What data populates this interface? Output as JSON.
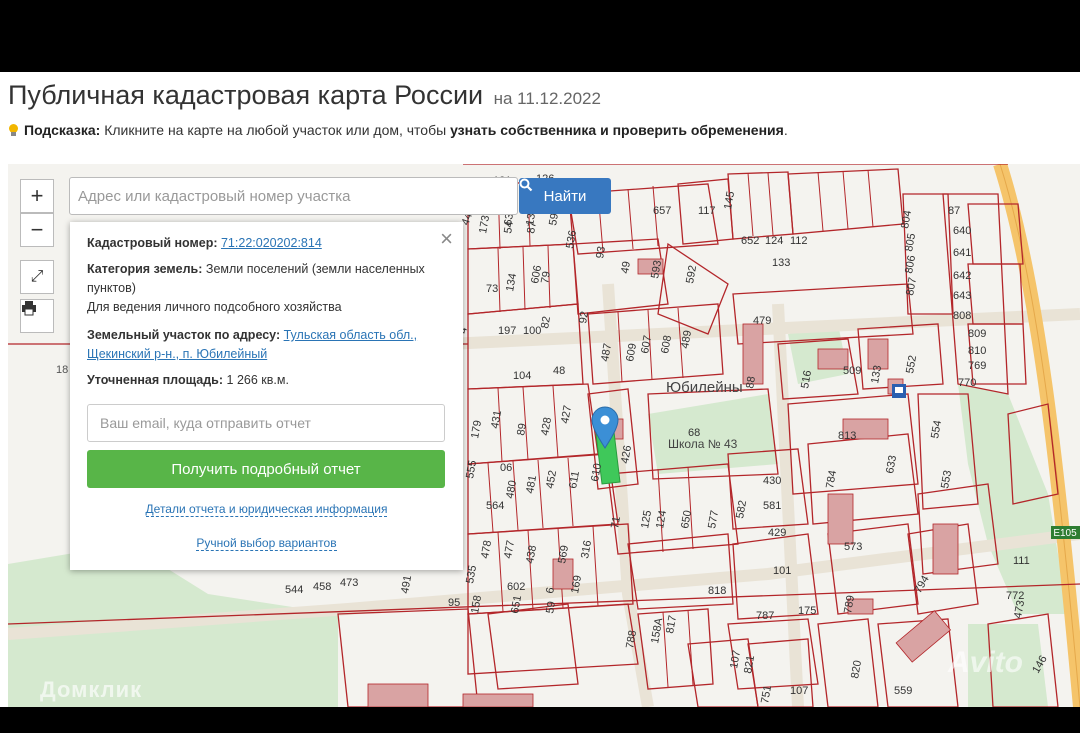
{
  "header": {
    "title": "Публичная кадастровая карта России",
    "date": "на 11.12.2022"
  },
  "hint": {
    "prefix": "Подсказка:",
    "text": "Кликните на карте на любой участок или дом, чтобы",
    "bold": "узнать собственника и проверить обременения",
    "suffix": "."
  },
  "search": {
    "placeholder": "Адрес или кадастровый номер участка",
    "button": "Найти"
  },
  "controls": {
    "zoom_in": "+",
    "zoom_out": "−"
  },
  "popup": {
    "cadastral_label": "Кадастровый номер:",
    "cadastral_value": "71:22:020202:814",
    "category_label": "Категория земель:",
    "category_value": "Земли поселений (земли населенных пунктов)",
    "usage": "Для ведения личного подсобного хозяйства",
    "address_label": "Земельный участок по адресу:",
    "address_value": "Тульская область обл., Щекинский р-н., п. Юбилейный",
    "area_label": "Уточненная площадь:",
    "area_value": "1 266 кв.м.",
    "email_placeholder": "Ваш email, куда отправить отчет",
    "report_button": "Получить подробный отчет",
    "details_link": "Детали отчета и юридическая информация",
    "manual_link": "Ручной выбор вариантов"
  },
  "map_labels": {
    "village": "Юбилейны",
    "school": "Школа № 43",
    "road": "Е105",
    "left_edge": "18",
    "plots": [
      "121",
      "126",
      "44",
      "638",
      "133",
      "59",
      "657",
      "117",
      "145",
      "87",
      "804",
      "640",
      "805",
      "641",
      "806",
      "642",
      "807",
      "643",
      "808",
      "809",
      "810",
      "769",
      "770",
      "652",
      "124",
      "112",
      "133",
      "173",
      "54",
      "87",
      "536",
      "93",
      "49",
      "593",
      "592",
      "79",
      "73",
      "134",
      "606",
      "92",
      "479",
      "4",
      "197",
      "100",
      "82",
      "487",
      "609",
      "607",
      "608",
      "489",
      "516",
      "509",
      "133",
      "552",
      "104",
      "48",
      "88",
      "179",
      "431",
      "89",
      "428",
      "427",
      "68",
      "426",
      "813",
      "554",
      "555",
      "06",
      "480",
      "481",
      "452",
      "611",
      "610",
      "430",
      "581",
      "582",
      "429",
      "633",
      "784",
      "553",
      "564",
      "71",
      "125",
      "124",
      "650",
      "577",
      "573",
      "478",
      "477",
      "438",
      "569",
      "316",
      "535",
      "602",
      "544",
      "458",
      "473",
      "491",
      "6",
      "169",
      "101",
      "111",
      "794",
      "772",
      "473",
      "95",
      "158",
      "651",
      "59",
      "787",
      "175",
      "789",
      "788",
      "158A",
      "817",
      "818",
      "107",
      "821",
      "107",
      "820",
      "559",
      "751",
      "146"
    ]
  },
  "watermarks": {
    "left": "Домклик",
    "right": "Avito"
  },
  "colors": {
    "plot_border": "#b3262a",
    "building": "#d9a3a3",
    "green_area": "#cfe8c8",
    "selected_plot": "#3fc85a",
    "road": "#f5c46a",
    "button_blue": "#3878c0",
    "button_green": "#58b548",
    "link": "#2a74b5"
  },
  "icons": {
    "hint": "lightbulb-icon",
    "search": "magnifier-icon",
    "fullscreen": "expand-icon",
    "print": "printer-icon",
    "close": "close-icon",
    "marker": "map-pin-icon",
    "bus": "bus-stop-icon"
  }
}
